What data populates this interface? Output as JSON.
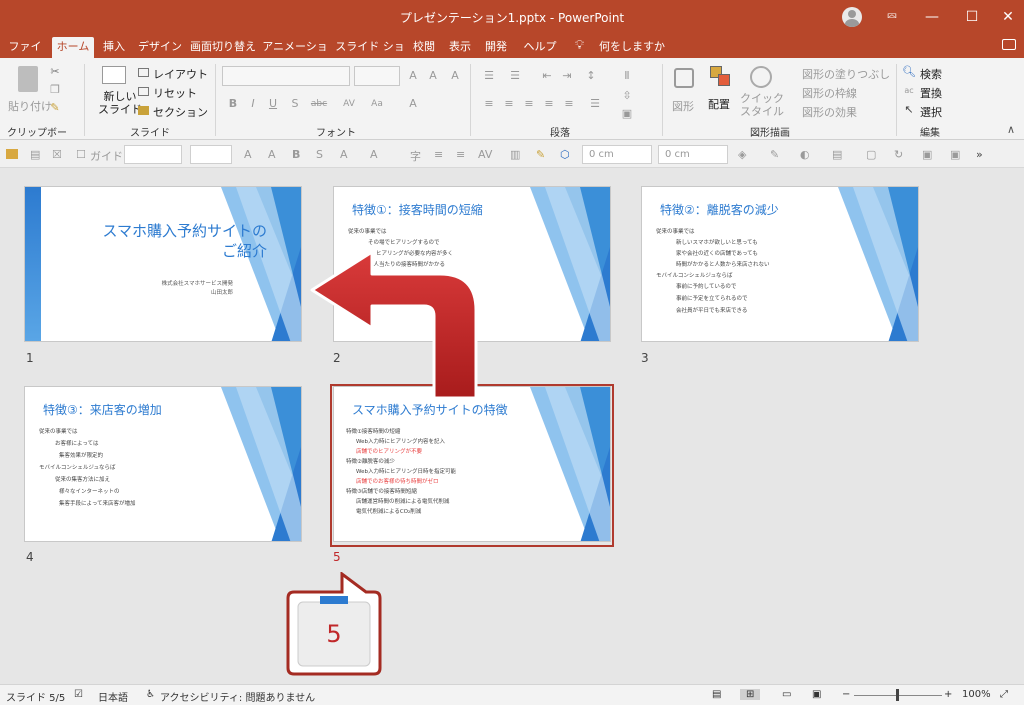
{
  "window": {
    "title": "プレゼンテーション1.pptx  -  PowerPoint"
  },
  "tabs": [
    "ファイル",
    "ホーム",
    "挿入",
    "デザイン",
    "画面切り替え",
    "アニメーション",
    "スライド ショー",
    "校閲",
    "表示",
    "開発",
    "ヘルプ",
    "何をしますか"
  ],
  "ribbon": {
    "groups": [
      "クリップボード",
      "スライド",
      "フォント",
      "段落",
      "図形描画",
      "編集"
    ],
    "paste": "貼り付け",
    "new_slide": "新しい\nスライド",
    "layout": "レイアウト",
    "reset": "リセット",
    "section": "セクション",
    "shape": "図形",
    "arrange": "配置",
    "quick_style": "クイック\nスタイル",
    "shape_fill": "図形の塗りつぶし",
    "shape_outline": "図形の枠線",
    "shape_effect": "図形の効果",
    "find": "検索",
    "replace": "置換",
    "select": "選択"
  },
  "quickbar": {
    "guide": "ガイド",
    "width": "0 cm",
    "height": "0 cm"
  },
  "slides": [
    {
      "num": "1",
      "title": "スマホ購入予約サイトの\nご紹介",
      "sub1": "株式会社スマホサービス開発",
      "sub2": "山田太郎"
    },
    {
      "num": "2",
      "title": "特徴①：接客時間の短縮",
      "lines": [
        "従来の事業では",
        "その場でヒアリングするので",
        "ヒアリングが必要な内容が多く",
        "一人当たりの接客時間がかかる"
      ]
    },
    {
      "num": "3",
      "title": "特徴②：離脱客の減少",
      "lines": [
        "従来の事業では",
        "新しいスマホが欲しいと思っても",
        "家や会社の近くの店舗であっても",
        "時間がかかると人数から来店されない",
        "モバイルコンシェルジュならば",
        "事前に予約しているので",
        "事前に予定を立てられるので",
        "会社員が平日でも来店できる"
      ]
    },
    {
      "num": "4",
      "title": "特徴③：来店客の増加",
      "lines": [
        "従来の事業では",
        "お客様によっては",
        "集客効果が限定的",
        "モバイルコンシェルジュならば",
        "従来の集客方法に加え",
        "様々なインターネットの",
        "集客手段によって来店客が増加"
      ]
    },
    {
      "num": "5",
      "title": "スマホ購入予約サイトの特徴",
      "lines": [
        "特徴①接客時間の短縮",
        "Web入力時にヒアリング内容を記入",
        "店舗でのヒアリングが不要",
        "特徴②離脱客の減少",
        "Web入力時にヒアリング日時を指定可能",
        "店舗でのお客様の待ち時間がゼロ",
        "特徴③店舗での接客時間短縮",
        "店舗運営時間の削減による電気代削減",
        "電気代削減によるCO₂削減"
      ]
    }
  ],
  "callout": {
    "num": "5"
  },
  "status": {
    "slide": "スライド 5/5",
    "lang": "日本語",
    "access": "アクセシビリティ: 問題ありません",
    "zoom": "100%"
  },
  "colors": {
    "accent": "#b7472a",
    "arrow": "#c0282a",
    "slide_blue": "#2d7bd0"
  }
}
